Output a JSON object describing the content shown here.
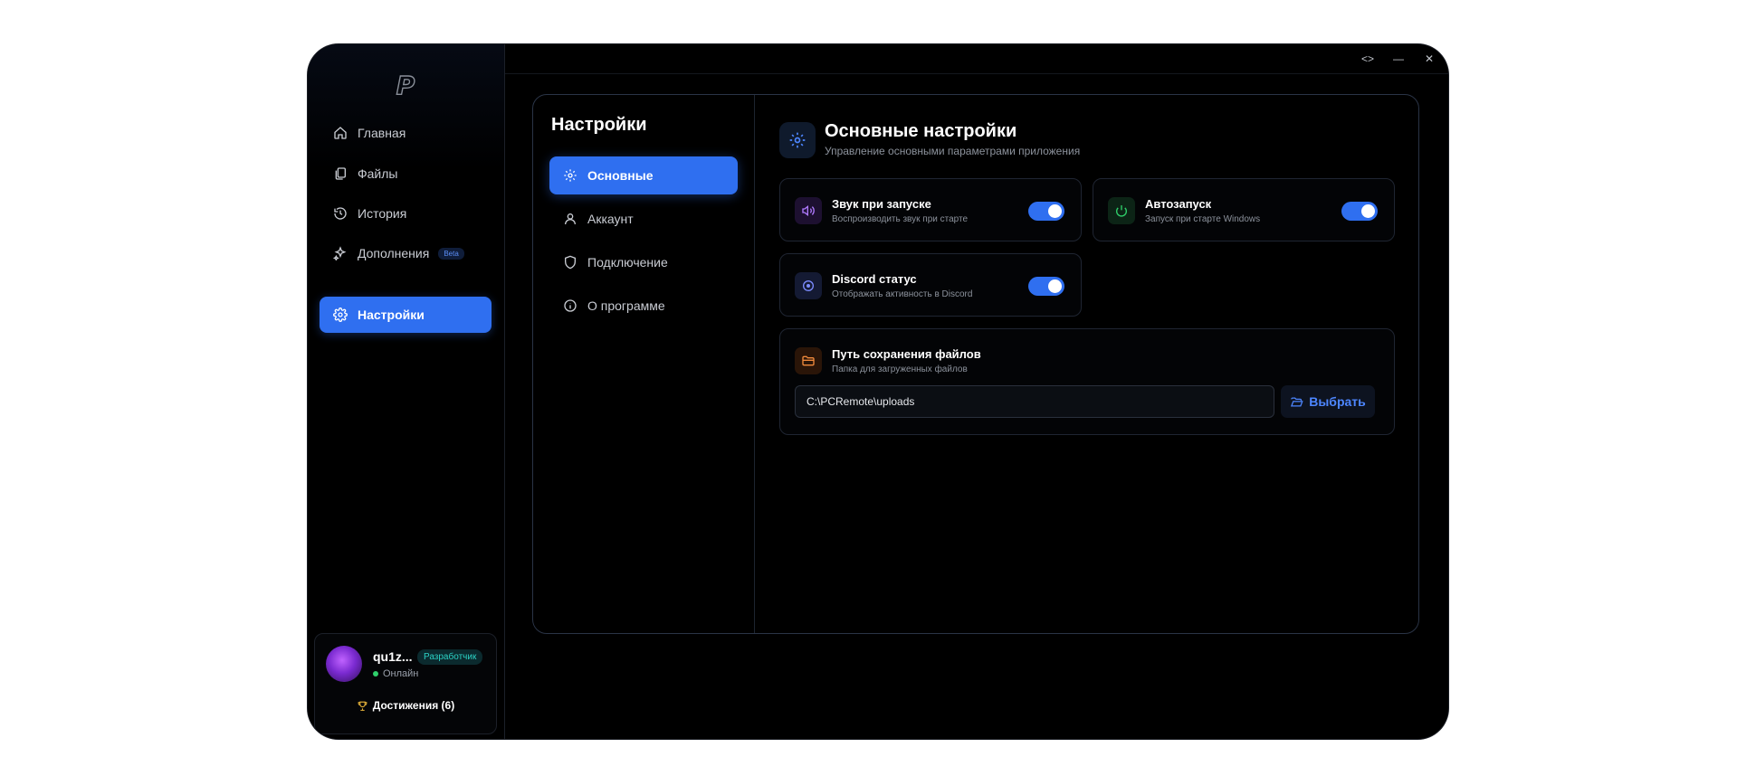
{
  "app": {
    "logo_letter": "P"
  },
  "nav": {
    "items": [
      {
        "label": "Главная",
        "icon": "home-icon"
      },
      {
        "label": "Файлы",
        "icon": "files-icon"
      },
      {
        "label": "История",
        "icon": "history-icon"
      },
      {
        "label": "Дополнения",
        "icon": "sparkles-icon",
        "badge": "Beta"
      },
      {
        "label": "Настройки",
        "icon": "gear-icon",
        "active": true
      }
    ]
  },
  "profile": {
    "name": "qu1z...",
    "role_badge": "Разработчик",
    "status": "Онлайн",
    "achievements": "Достижения (6)"
  },
  "window_controls": {
    "code": "<>",
    "minimize": "—",
    "close": "✕"
  },
  "settings": {
    "title": "Настройки",
    "tabs": [
      {
        "label": "Основные",
        "icon": "gear-icon",
        "active": true
      },
      {
        "label": "Аккаунт",
        "icon": "user-icon"
      },
      {
        "label": "Подключение",
        "icon": "shield-icon"
      },
      {
        "label": "О программе",
        "icon": "info-icon"
      }
    ]
  },
  "general": {
    "title": "Основные настройки",
    "subtitle": "Управление основными параметрами приложения",
    "sound": {
      "title": "Звук при запуске",
      "desc": "Воспроизводить звук при старте",
      "enabled": true
    },
    "autostart": {
      "title": "Автозапуск",
      "desc": "Запуск при старте Windows",
      "enabled": true
    },
    "discord": {
      "title": "Discord статус",
      "desc": "Отображать активность в Discord",
      "enabled": true
    },
    "save_path": {
      "title": "Путь сохранения файлов",
      "desc": "Папка для загруженных файлов",
      "value": "C:\\PCRemote\\uploads",
      "button": "Выбрать"
    }
  },
  "colors": {
    "accent": "#2f6ff0",
    "background": "#000000",
    "online": "#2fd06b",
    "dev_badge": "#2bd1c4"
  }
}
